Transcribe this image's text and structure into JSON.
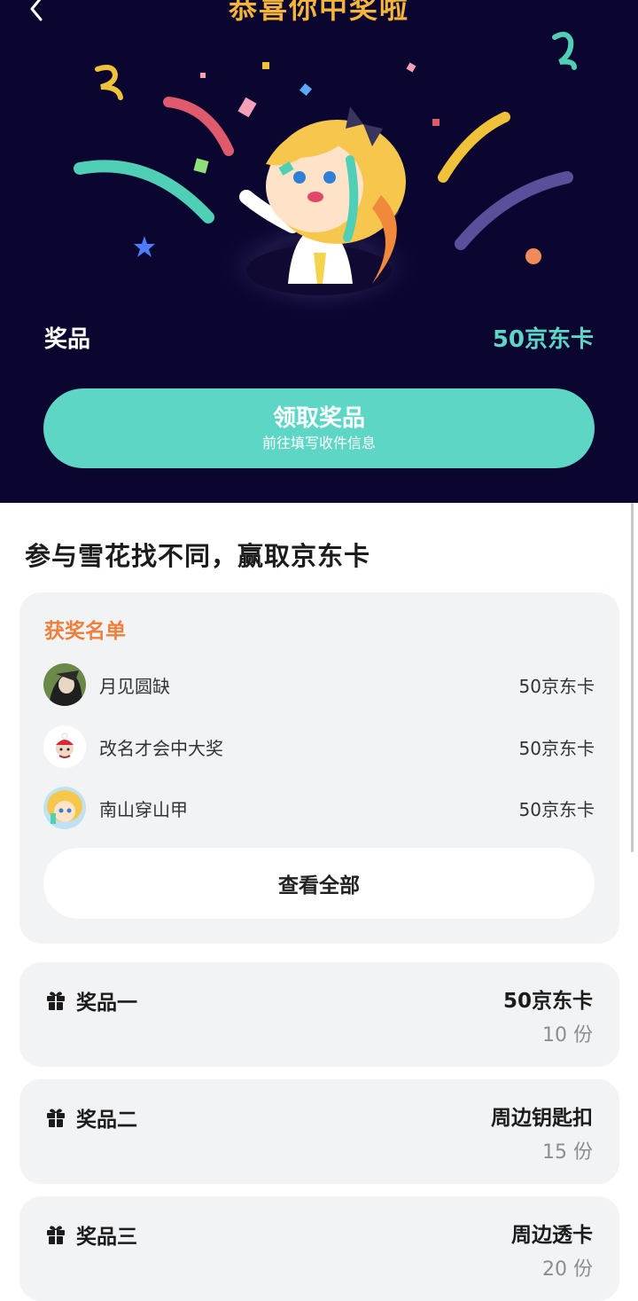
{
  "header": {
    "title": "恭喜你中奖啦"
  },
  "result": {
    "prize_label": "奖品",
    "prize_value": "50京东卡",
    "claim_button": "领取奖品",
    "claim_subtext": "前往填写收件信息"
  },
  "activity": {
    "title": "参与雪花找不同，赢取京东卡"
  },
  "winners": {
    "title": "获奖名单",
    "items": [
      {
        "name": "月见圆缺",
        "prize": "50京东卡"
      },
      {
        "name": "改名才会中大奖",
        "prize": "50京东卡"
      },
      {
        "name": "南山穿山甲",
        "prize": "50京东卡"
      }
    ],
    "view_all": "查看全部"
  },
  "prizes": [
    {
      "name": "奖品一",
      "value": "50京东卡",
      "count": "10 份"
    },
    {
      "name": "奖品二",
      "value": "周边钥匙扣",
      "count": "15 份"
    },
    {
      "name": "奖品三",
      "value": "周边透卡",
      "count": "20 份"
    }
  ],
  "colors": {
    "hero_bg": "#0b0630",
    "accent_teal": "#5ed6c6",
    "title_gold": "#f5b53a",
    "winners_orange": "#ef7f3d",
    "card_bg": "#f2f3f5"
  },
  "icons": [
    "back-arrow-icon",
    "gift-icon"
  ]
}
